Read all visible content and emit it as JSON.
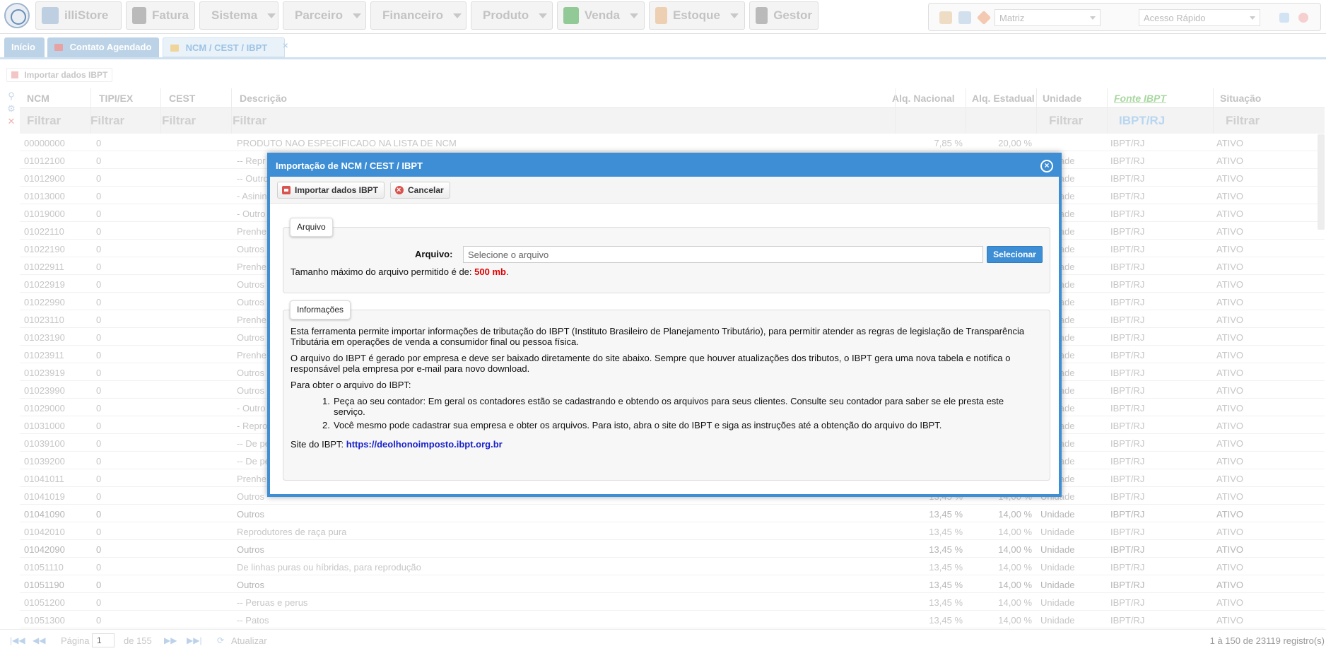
{
  "menu": [
    {
      "label": "illiStore",
      "icon": "store-icon",
      "color": "#8fb0cf",
      "caret": false
    },
    {
      "label": "Fatura",
      "icon": "barcode-icon",
      "color": "#8a8a8a",
      "caret": false
    },
    {
      "label": "Sistema",
      "icon": "gear-icon",
      "color": "#5f86b8",
      "caret": true
    },
    {
      "label": "Parceiro",
      "icon": "users-icon",
      "color": "#b58a5a",
      "caret": true
    },
    {
      "label": "Financeiro",
      "icon": "bar-chart-icon",
      "color": "#f0b43c",
      "caret": true
    },
    {
      "label": "Produto",
      "icon": "box-icon",
      "color": "#e8b040",
      "caret": true
    },
    {
      "label": "Venda",
      "icon": "cart-icon",
      "color": "#3fa84a",
      "caret": true
    },
    {
      "label": "Estoque",
      "icon": "hands-icon",
      "color": "#e6b27a",
      "caret": true
    },
    {
      "label": "Gestor",
      "icon": "presentation-icon",
      "color": "#8a8a8a",
      "caret": false
    }
  ],
  "topright": {
    "branch_value": "Matriz",
    "quick_access_placeholder": "Acesso Rápido"
  },
  "tabs": [
    {
      "label": "Início",
      "active": false
    },
    {
      "label": "Contato Agendado",
      "active": false
    },
    {
      "label": "NCM / CEST / IBPT",
      "active": true
    }
  ],
  "toolbar": {
    "import_label": "Importar dados IBPT"
  },
  "grid": {
    "columns": [
      "NCM",
      "TIPI/EX",
      "CEST",
      "Descrição",
      "Alq. Nacional",
      "Alq. Estadual",
      "Unidade",
      "Fonte IBPT",
      "Situação"
    ],
    "filters": {
      "ncm": "Filtrar",
      "tipi": "Filtrar",
      "cest": "Filtrar",
      "desc": "Filtrar",
      "unidade": "Filtrar",
      "fonte": "IBPT/RJ",
      "situacao": "Filtrar"
    },
    "rows": [
      {
        "ncm": "00000000",
        "tipi": "0",
        "desc": "PRODUTO NAO ESPECIFICADO NA LISTA DE NCM",
        "nac": "7,85 %",
        "est": "20,00 %",
        "un": "",
        "fonte": "IBPT/RJ",
        "sit": "ATIVO"
      },
      {
        "ncm": "01012100",
        "tipi": "0",
        "desc": "-- Repr",
        "nac": "",
        "est": "",
        "un": "Unidade",
        "fonte": "IBPT/RJ",
        "sit": "ATIVO"
      },
      {
        "ncm": "01012900",
        "tipi": "0",
        "desc": "-- Outro",
        "nac": "",
        "est": "",
        "un": "Unidade",
        "fonte": "IBPT/RJ",
        "sit": "ATIVO"
      },
      {
        "ncm": "01013000",
        "tipi": "0",
        "desc": "- Asinin",
        "nac": "",
        "est": "",
        "un": "Unidade",
        "fonte": "IBPT/RJ",
        "sit": "ATIVO"
      },
      {
        "ncm": "01019000",
        "tipi": "0",
        "desc": "- Outro",
        "nac": "",
        "est": "",
        "un": "Unidade",
        "fonte": "IBPT/RJ",
        "sit": "ATIVO"
      },
      {
        "ncm": "01022110",
        "tipi": "0",
        "desc": "Prenhe",
        "nac": "",
        "est": "",
        "un": "Unidade",
        "fonte": "IBPT/RJ",
        "sit": "ATIVO"
      },
      {
        "ncm": "01022190",
        "tipi": "0",
        "desc": "Outros",
        "nac": "",
        "est": "",
        "un": "Unidade",
        "fonte": "IBPT/RJ",
        "sit": "ATIVO"
      },
      {
        "ncm": "01022911",
        "tipi": "0",
        "desc": "Prenhe",
        "nac": "",
        "est": "",
        "un": "Unidade",
        "fonte": "IBPT/RJ",
        "sit": "ATIVO"
      },
      {
        "ncm": "01022919",
        "tipi": "0",
        "desc": "Outros",
        "nac": "",
        "est": "",
        "un": "Unidade",
        "fonte": "IBPT/RJ",
        "sit": "ATIVO"
      },
      {
        "ncm": "01022990",
        "tipi": "0",
        "desc": "Outros",
        "nac": "",
        "est": "",
        "un": "Unidade",
        "fonte": "IBPT/RJ",
        "sit": "ATIVO"
      },
      {
        "ncm": "01023110",
        "tipi": "0",
        "desc": "Prenhe",
        "nac": "",
        "est": "",
        "un": "Unidade",
        "fonte": "IBPT/RJ",
        "sit": "ATIVO"
      },
      {
        "ncm": "01023190",
        "tipi": "0",
        "desc": "Outros",
        "nac": "",
        "est": "",
        "un": "Unidade",
        "fonte": "IBPT/RJ",
        "sit": "ATIVO"
      },
      {
        "ncm": "01023911",
        "tipi": "0",
        "desc": "Prenhe",
        "nac": "",
        "est": "",
        "un": "Unidade",
        "fonte": "IBPT/RJ",
        "sit": "ATIVO"
      },
      {
        "ncm": "01023919",
        "tipi": "0",
        "desc": "Outros",
        "nac": "",
        "est": "",
        "un": "Unidade",
        "fonte": "IBPT/RJ",
        "sit": "ATIVO"
      },
      {
        "ncm": "01023990",
        "tipi": "0",
        "desc": "Outros",
        "nac": "",
        "est": "",
        "un": "Unidade",
        "fonte": "IBPT/RJ",
        "sit": "ATIVO"
      },
      {
        "ncm": "01029000",
        "tipi": "0",
        "desc": "- Outro",
        "nac": "",
        "est": "",
        "un": "Unidade",
        "fonte": "IBPT/RJ",
        "sit": "ATIVO"
      },
      {
        "ncm": "01031000",
        "tipi": "0",
        "desc": "- Repro",
        "nac": "",
        "est": "",
        "un": "Unidade",
        "fonte": "IBPT/RJ",
        "sit": "ATIVO"
      },
      {
        "ncm": "01039100",
        "tipi": "0",
        "desc": "-- De pe",
        "nac": "",
        "est": "",
        "un": "Unidade",
        "fonte": "IBPT/RJ",
        "sit": "ATIVO"
      },
      {
        "ncm": "01039200",
        "tipi": "0",
        "desc": "-- De pe",
        "nac": "",
        "est": "",
        "un": "Unidade",
        "fonte": "IBPT/RJ",
        "sit": "ATIVO"
      },
      {
        "ncm": "01041011",
        "tipi": "0",
        "desc": "Prenhe",
        "nac": "",
        "est": "",
        "un": "Unidade",
        "fonte": "IBPT/RJ",
        "sit": "ATIVO"
      },
      {
        "ncm": "01041019",
        "tipi": "0",
        "desc": "Outros",
        "nac": "13,45 %",
        "est": "14,00 %",
        "un": "Unidade",
        "fonte": "IBPT/RJ",
        "sit": "ATIVO"
      },
      {
        "ncm": "01041090",
        "tipi": "0",
        "desc": "Outros",
        "nac": "13,45 %",
        "est": "14,00 %",
        "un": "Unidade",
        "fonte": "IBPT/RJ",
        "sit": "ATIVO"
      },
      {
        "ncm": "01042010",
        "tipi": "0",
        "desc": "Reprodutores de raça pura",
        "nac": "13,45 %",
        "est": "14,00 %",
        "un": "Unidade",
        "fonte": "IBPT/RJ",
        "sit": "ATIVO"
      },
      {
        "ncm": "01042090",
        "tipi": "0",
        "desc": "Outros",
        "nac": "13,45 %",
        "est": "14,00 %",
        "un": "Unidade",
        "fonte": "IBPT/RJ",
        "sit": "ATIVO"
      },
      {
        "ncm": "01051110",
        "tipi": "0",
        "desc": "De linhas puras ou híbridas, para reprodução",
        "nac": "13,45 %",
        "est": "14,00 %",
        "un": "Unidade",
        "fonte": "IBPT/RJ",
        "sit": "ATIVO"
      },
      {
        "ncm": "01051190",
        "tipi": "0",
        "desc": "Outros",
        "nac": "13,45 %",
        "est": "14,00 %",
        "un": "Unidade",
        "fonte": "IBPT/RJ",
        "sit": "ATIVO"
      },
      {
        "ncm": "01051200",
        "tipi": "0",
        "desc": "-- Peruas e perus",
        "nac": "13,45 %",
        "est": "14,00 %",
        "un": "Unidade",
        "fonte": "IBPT/RJ",
        "sit": "ATIVO"
      },
      {
        "ncm": "01051300",
        "tipi": "0",
        "desc": "-- Patos",
        "nac": "13,45 %",
        "est": "14,00 %",
        "un": "Unidade",
        "fonte": "IBPT/RJ",
        "sit": "ATIVO"
      }
    ]
  },
  "pager": {
    "page_label": "Página",
    "page_value": "1",
    "of_label": "de 155",
    "refresh_label": "Atualizar",
    "records": "1 à 150 de 23119 registro(s)"
  },
  "dialog": {
    "title": "Importação de NCM / CEST / IBPT",
    "import_label": "Importar dados IBPT",
    "cancel_label": "Cancelar",
    "arquivo": {
      "legend": "Arquivo",
      "field_label": "Arquivo:",
      "placeholder": "Selecione o arquivo",
      "select_label": "Selecionar",
      "max_size_text": "Tamanho máximo do arquivo permitido é de: ",
      "max_size_value": "500 mb",
      "max_size_end": "."
    },
    "info": {
      "legend": "Informações",
      "p1": "Esta ferramenta permite importar informações de tributação do IBPT (Instituto Brasileiro de Planejamento Tributário), para permitir atender as regras de legislação de Transparência Tributária em operações de venda a consumidor final ou pessoa física.",
      "p2": "O arquivo do IBPT é gerado por empresa e deve ser baixado diretamente do site abaixo. Sempre que houver atualizações dos tributos, o IBPT gera uma nova tabela e notifica o responsável pela empresa por e-mail para novo download.",
      "p3": "Para obter o arquivo do IBPT:",
      "steps": [
        "Peça ao seu contador: Em geral os contadores estão se cadastrando e obtendo os arquivos para seus clientes. Consulte seu contador para saber se ele presta este serviço.",
        "Você mesmo pode cadastrar sua empresa e obter os arquivos. Para isto, abra o site do IBPT e siga as instruções até a obtenção do arquivo do IBPT."
      ],
      "site_label": "Site do IBPT: ",
      "site_url": "https://deolhonoimposto.ibpt.org.br"
    }
  }
}
